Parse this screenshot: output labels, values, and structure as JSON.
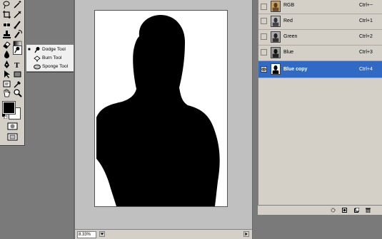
{
  "toolbox": {
    "tools": [
      "marquee-tool",
      "move-tool",
      "lasso-tool",
      "magic-wand-tool",
      "crop-tool",
      "slice-tool",
      "healing-brush-tool",
      "brush-tool",
      "clone-stamp-tool",
      "history-brush-tool",
      "eraser-tool",
      "gradient-tool",
      "blur-tool",
      "dodge-tool",
      "pen-tool",
      "type-tool",
      "path-selection-tool",
      "shape-tool",
      "notes-tool",
      "eyedropper-tool",
      "hand-tool",
      "zoom-tool"
    ],
    "foreground_color": "#000000",
    "background_color": "#ffffff"
  },
  "flyout": {
    "items": [
      {
        "label": "Dodge Tool",
        "icon": "dodge-icon",
        "selected": true
      },
      {
        "label": "Burn Tool",
        "icon": "burn-icon",
        "selected": false
      },
      {
        "label": "Sponge Tool",
        "icon": "sponge-icon",
        "selected": false
      }
    ]
  },
  "document": {
    "zoom": "8.33%"
  },
  "channels": {
    "rows": [
      {
        "name": "RGB",
        "shortcut": "Ctrl+~",
        "visible": false,
        "selected": false
      },
      {
        "name": "Red",
        "shortcut": "Ctrl+1",
        "visible": false,
        "selected": false
      },
      {
        "name": "Green",
        "shortcut": "Ctrl+2",
        "visible": false,
        "selected": false
      },
      {
        "name": "Blue",
        "shortcut": "Ctrl+3",
        "visible": false,
        "selected": false
      },
      {
        "name": "Blue copy",
        "shortcut": "Ctrl+4",
        "visible": true,
        "selected": true
      }
    ],
    "footer_icons": [
      "load-selection-icon",
      "save-selection-icon",
      "new-channel-icon",
      "delete-channel-icon"
    ]
  },
  "colors": {
    "selection": "#316ac5",
    "workspace": "#7a7a7a",
    "panel": "#d4d0c8"
  }
}
